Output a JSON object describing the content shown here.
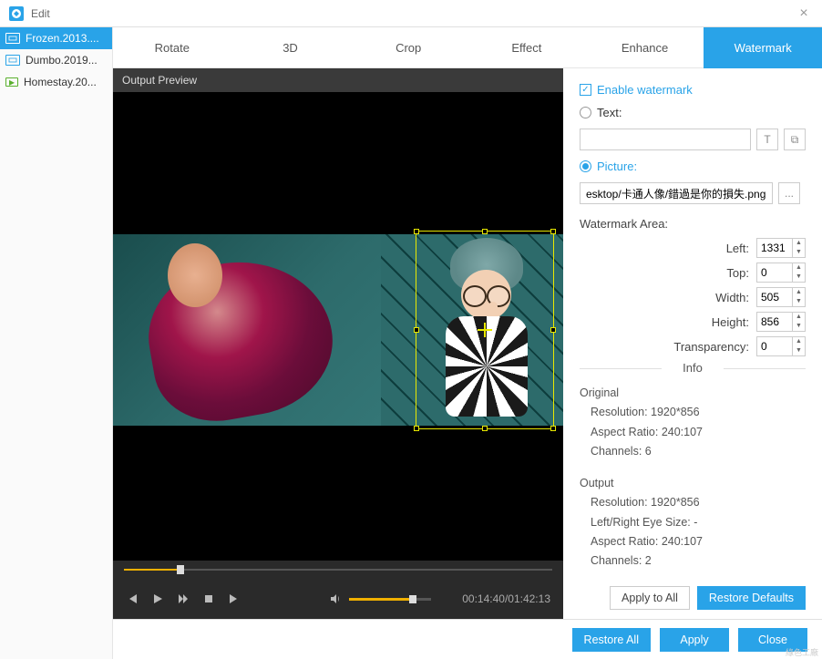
{
  "window": {
    "title": "Edit"
  },
  "sidebar": {
    "items": [
      {
        "label": "Frozen.2013....",
        "active": true,
        "type": "video"
      },
      {
        "label": "Dumbo.2019...",
        "active": false,
        "type": "video"
      },
      {
        "label": "Homestay.20...",
        "active": false,
        "type": "other"
      }
    ]
  },
  "tabs": {
    "items": [
      {
        "label": "Rotate",
        "active": false
      },
      {
        "label": "3D",
        "active": false
      },
      {
        "label": "Crop",
        "active": false
      },
      {
        "label": "Effect",
        "active": false
      },
      {
        "label": "Enhance",
        "active": false
      },
      {
        "label": "Watermark",
        "active": true
      }
    ]
  },
  "preview": {
    "header": "Output Preview",
    "time_current": "00:14:40",
    "time_total": "01:42:13"
  },
  "watermark": {
    "enable_label": "Enable watermark",
    "enable_checked": true,
    "text_label": "Text:",
    "text_value": "",
    "text_selected": false,
    "picture_label": "Picture:",
    "picture_selected": true,
    "picture_path": "esktop/卡通人像/錯過是你的損失.png",
    "browse_label": "...",
    "area_label": "Watermark Area:",
    "fields": {
      "left_label": "Left:",
      "left_value": "1331",
      "top_label": "Top:",
      "top_value": "0",
      "width_label": "Width:",
      "width_value": "505",
      "height_label": "Height:",
      "height_value": "856",
      "transparency_label": "Transparency:",
      "transparency_value": "0"
    }
  },
  "info": {
    "title": "Info",
    "original": {
      "heading": "Original",
      "resolution_label": "Resolution:",
      "resolution_value": "1920*856",
      "aspect_label": "Aspect Ratio:",
      "aspect_value": "240:107",
      "channels_label": "Channels:",
      "channels_value": "6"
    },
    "output": {
      "heading": "Output",
      "resolution_label": "Resolution:",
      "resolution_value": "1920*856",
      "eye_label": "Left/Right Eye Size:",
      "eye_value": "-",
      "aspect_label": "Aspect Ratio:",
      "aspect_value": "240:107",
      "channels_label": "Channels:",
      "channels_value": "2"
    }
  },
  "buttons": {
    "apply_all": "Apply to All",
    "restore_defaults": "Restore Defaults",
    "restore_all": "Restore All",
    "apply": "Apply",
    "close": "Close"
  },
  "footer": "綠色工廠"
}
